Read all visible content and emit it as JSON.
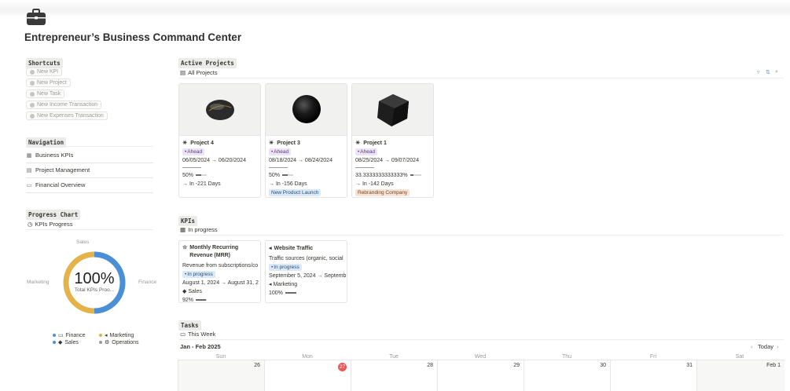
{
  "page": {
    "title": "Entrepreneur’s Business Command Center",
    "icon": "briefcase-icon"
  },
  "shortcuts": {
    "tag": "Shortcuts",
    "items": [
      "New KPI",
      "New Project",
      "New Task",
      "New Income Transaction",
      "New Expenses Transaction"
    ]
  },
  "navigation": {
    "tag": "Navigation",
    "items": [
      {
        "label": "Business KPIs",
        "icon": "chart-icon"
      },
      {
        "label": "Project Management",
        "icon": "building-icon"
      },
      {
        "label": "Financial Overview",
        "icon": "money-icon"
      }
    ]
  },
  "progress_chart": {
    "tag": "Progress Chart",
    "view": "KPIs Progress",
    "center_value": "100%",
    "center_label": "Total KPIs Proo...",
    "labels": {
      "top": "Sales",
      "left": "Marketing",
      "right": "Finance"
    },
    "legend": [
      {
        "label": "Finance",
        "color": "#4a90d9",
        "icon": "money-icon"
      },
      {
        "label": "Marketing",
        "color": "#e3b34a",
        "icon": "megaphone-icon"
      },
      {
        "label": "Sales",
        "color": "#4a90d9",
        "icon": "tag-icon"
      },
      {
        "label": "Operations",
        "color": "#9b9a97",
        "icon": "gear-icon"
      }
    ],
    "segments": [
      {
        "name": "Finance",
        "fraction": 0.5,
        "color": "#4a90d9"
      },
      {
        "name": "Marketing",
        "fraction": 0.5,
        "color": "#e3b34a"
      }
    ]
  },
  "active_projects": {
    "tag": "Active Projects",
    "view": "All Projects",
    "cards": [
      {
        "name": "Project 4",
        "status": "Ahead",
        "dates": "06/05/2024 → 06/20/2024",
        "percent": "50%",
        "progress": 0.5,
        "days": "→ In -221 Days",
        "tag": "",
        "tag_class": "",
        "shape": "disc"
      },
      {
        "name": "Project 3",
        "status": "Ahead",
        "dates": "08/18/2024 → 08/24/2024",
        "percent": "50%",
        "progress": 0.5,
        "days": "→ In -156 Days",
        "tag": "New Product Launch",
        "tag_class": "b-blue",
        "shape": "sphere"
      },
      {
        "name": "Project 1",
        "status": "Ahead",
        "dates": "08/25/2024 → 09/07/2024",
        "percent": "33.3333333333333%",
        "progress": 0.333,
        "days": "→ In -142 Days",
        "tag": "Rebranding Company",
        "tag_class": "b-orange",
        "shape": "cube"
      }
    ]
  },
  "kpis": {
    "tag": "KPIs",
    "view": "In progress",
    "cards": [
      {
        "name": "Monthly Recurring Revenue (MRR)",
        "name_line1": "Monthly Recurring",
        "name_line2": "Revenue (MRR)",
        "description": "Revenue from subscriptions/co",
        "status": "In progress",
        "dates": "August 1, 2024 → August 31, 2",
        "category": "Sales",
        "percent": "92%",
        "progress": 0.92
      },
      {
        "name": "Website Traffic",
        "description": "Traffic sources (organic, social",
        "status": "In progress",
        "dates": "September 5, 2024 → Septemb",
        "category": "Marketing",
        "percent": "100%",
        "progress": 1.0
      }
    ]
  },
  "tasks": {
    "tag": "Tasks",
    "view": "This Week",
    "range": "Jan - Feb 2025",
    "today_label": "Today",
    "weekdays": [
      "Sun",
      "Mon",
      "Tue",
      "Wed",
      "Thu",
      "Fri",
      "Sat"
    ],
    "days": [
      "26",
      "27",
      "28",
      "29",
      "30",
      "31",
      "Feb 1"
    ]
  }
}
